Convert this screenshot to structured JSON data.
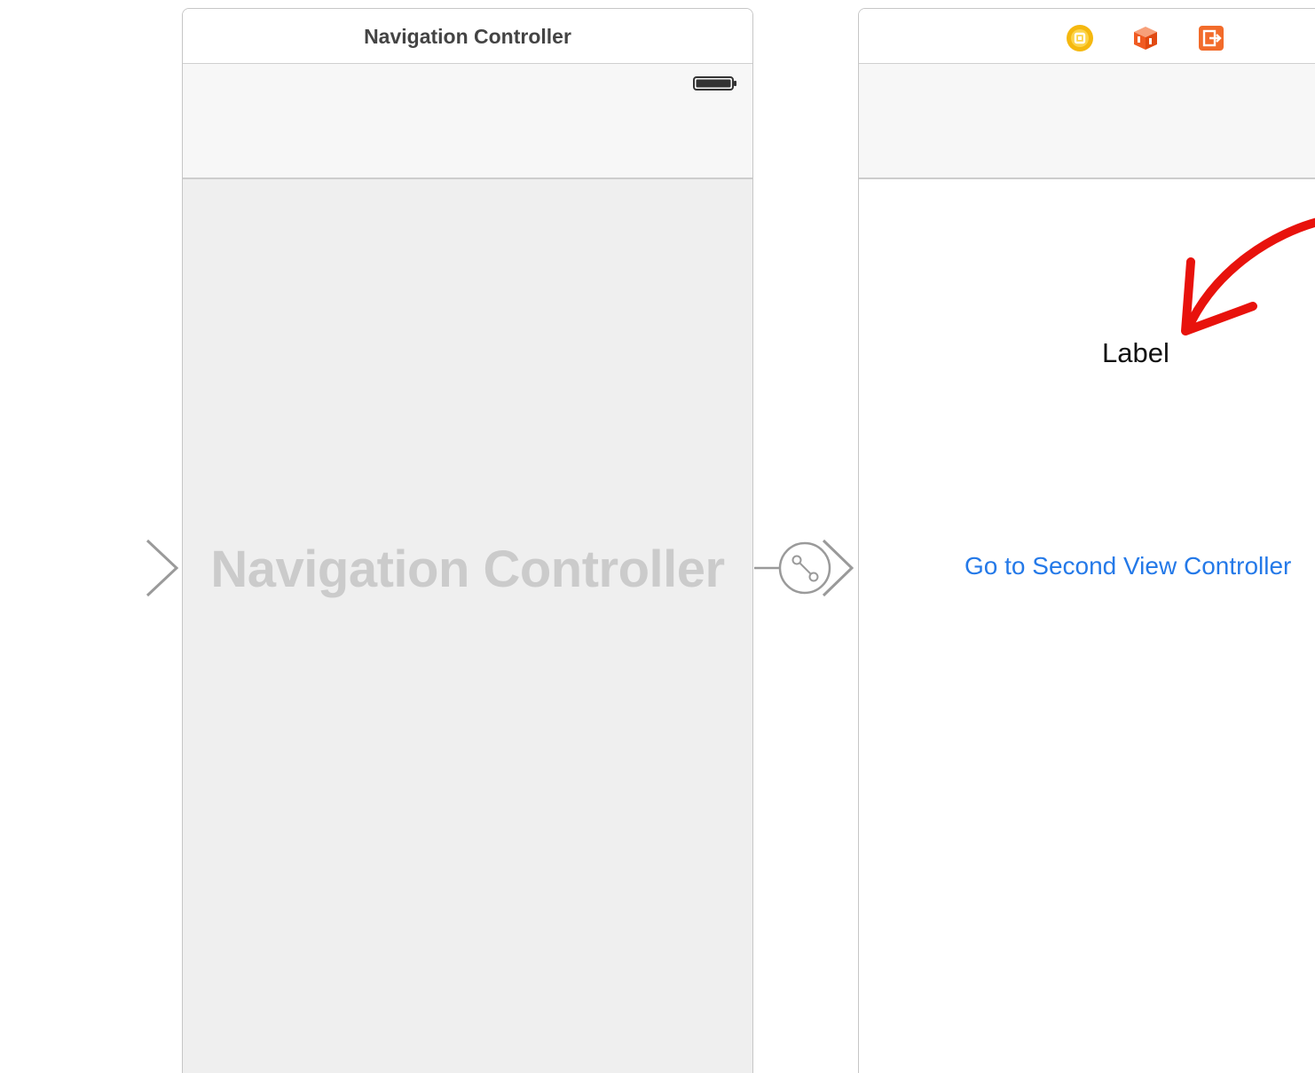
{
  "navigation_controller_scene": {
    "title": "Navigation Controller",
    "placeholder_title": "Navigation Controller",
    "status_icon": "battery-icon"
  },
  "view_controller_scene": {
    "dock_icons": [
      "view-controller-icon",
      "first-responder-icon",
      "exit-icon"
    ],
    "label": "Label",
    "button_title": "Go to Second View Controller"
  },
  "connectors": {
    "entry_point": "initial-view-controller-arrow",
    "segue": "root-view-controller-relationship-segue"
  },
  "annotation": {
    "shape": "red-arrow",
    "color": "#e8120c"
  },
  "colors": {
    "link_blue": "#2479e8",
    "scene_border": "#c6c6c6",
    "watermark_gray": "#cbcbcb"
  }
}
